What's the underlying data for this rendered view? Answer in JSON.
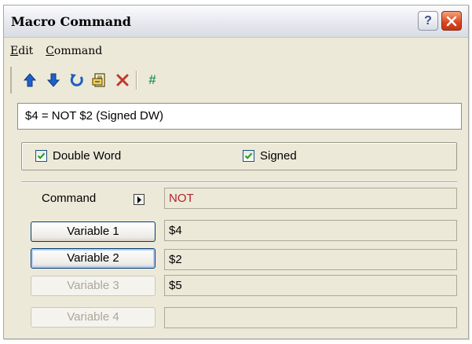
{
  "window": {
    "title": "Macro Command"
  },
  "menu": [
    {
      "mnemonic": "E",
      "rest": "dit"
    },
    {
      "mnemonic": "C",
      "rest": "ommand"
    }
  ],
  "toolbar": {
    "icons": [
      "arrow-up-icon",
      "arrow-down-icon",
      "refresh-icon",
      "document-icon",
      "delete-icon",
      "hash-icon"
    ],
    "hash_symbol": "#"
  },
  "command_text": "$4 = NOT $2 (Signed DW)",
  "options": {
    "double_word": {
      "label": "Double Word",
      "checked": true
    },
    "signed": {
      "label": "Signed",
      "checked": true
    }
  },
  "rows": {
    "command": {
      "label": "Command",
      "value": "NOT"
    },
    "var1": {
      "label": "Variable 1",
      "value": "$4"
    },
    "var2": {
      "label": "Variable 2",
      "value": "$2"
    },
    "var3": {
      "label": "Variable 3",
      "value": "$5"
    },
    "var4": {
      "label": "Variable 4",
      "value": ""
    }
  },
  "colors": {
    "command_value": "#b2242c",
    "toolbar_icon": "#1f5fc6",
    "delete_icon": "#c0392b",
    "hash_icon": "#2e9a64"
  }
}
